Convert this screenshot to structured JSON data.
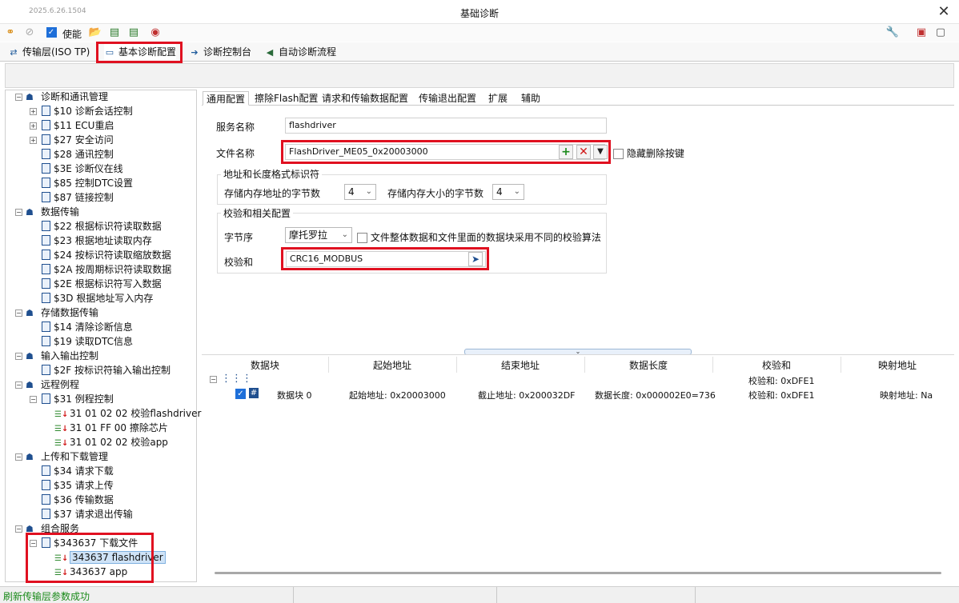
{
  "window": {
    "version": "2025.6.26.1504",
    "title": "基础诊断"
  },
  "toolbar": {
    "enable_label": "使能"
  },
  "top_tabs": [
    {
      "label": "传输层(ISO TP)",
      "icon": "swap-icon"
    },
    {
      "label": "基本诊断配置",
      "icon": "window-icon"
    },
    {
      "label": "诊断控制台",
      "icon": "console-icon"
    },
    {
      "label": "自动诊断流程",
      "icon": "send-icon"
    }
  ],
  "tree": {
    "g1": "诊断和通讯管理",
    "g1_items": [
      "$10 诊断会话控制",
      "$11 ECU重启",
      "$27 安全访问",
      "$28 通讯控制",
      "$3E 诊断仪在线",
      "$85 控制DTC设置",
      "$87 链接控制"
    ],
    "g2": "数据传输",
    "g2_items": [
      "$22 根据标识符读取数据",
      "$23 根据地址读取内存",
      "$24 按标识符读取缩放数据",
      "$2A 按周期标识符读取数据",
      "$2E 根据标识符写入数据",
      "$3D 根据地址写入内存"
    ],
    "g3": "存储数据传输",
    "g3_items": [
      "$14 清除诊断信息",
      "$19 读取DTC信息"
    ],
    "g4": "输入输出控制",
    "g4_items": [
      "$2F 按标识符输入输出控制"
    ],
    "g5": "远程例程",
    "g5_item": "$31 例程控制",
    "g5_sub": [
      "31 01 02 02 校验flashdriver",
      "31 01 FF 00 擦除芯片",
      "31 01 02 02 校验app"
    ],
    "g6": "上传和下载管理",
    "g6_items": [
      "$34 请求下载",
      "$35 请求上传",
      "$36 传输数据",
      "$37 请求退出传输"
    ],
    "g7": "组合服务",
    "g7_item": "$343637 下载文件",
    "g7_sub": [
      "343637 flashdriver",
      "343637 app"
    ]
  },
  "right_tabs": [
    "通用配置",
    "擦除Flash配置",
    "请求和传输数据配置",
    "传输退出配置",
    "扩展",
    "辅助"
  ],
  "form": {
    "service_name_label": "服务名称",
    "service_name_value": "flashdriver",
    "file_name_label": "文件名称",
    "file_name_value": "FlashDriver_ME05_0x20003000",
    "hide_delete_label": "隐藏删除按键",
    "addr_group_title": "地址和长度格式标识符",
    "addr_bytes_label": "存储内存地址的字节数",
    "addr_bytes_value": "4",
    "size_bytes_label": "存储内存大小的字节数",
    "size_bytes_value": "4",
    "checksum_group_title": "校验和相关配置",
    "byte_order_label": "字节序",
    "byte_order_value": "摩托罗拉",
    "diff_algo_label": "文件整体数据和文件里面的数据块采用不同的校验算法",
    "checksum_label": "校验和",
    "checksum_value": "CRC16_MODBUS"
  },
  "grid": {
    "headers": [
      "数据块",
      "起始地址",
      "结束地址",
      "数据长度",
      "校验和",
      "映射地址"
    ],
    "root_checksum": "校验和: 0xDFE1",
    "row": {
      "name": "数据块 0",
      "start": "起始地址: 0x20003000",
      "end": "截止地址: 0x200032DF",
      "length": "数据长度: 0x000002E0=736",
      "checksum": "校验和: 0xDFE1",
      "map": "映射地址: Na"
    }
  },
  "status": {
    "message": "刷新传输层参数成功"
  },
  "colors": {
    "highlight_red": "#e01020",
    "status_green": "#1a8a1a",
    "accent_blue": "#1e6fd9"
  }
}
